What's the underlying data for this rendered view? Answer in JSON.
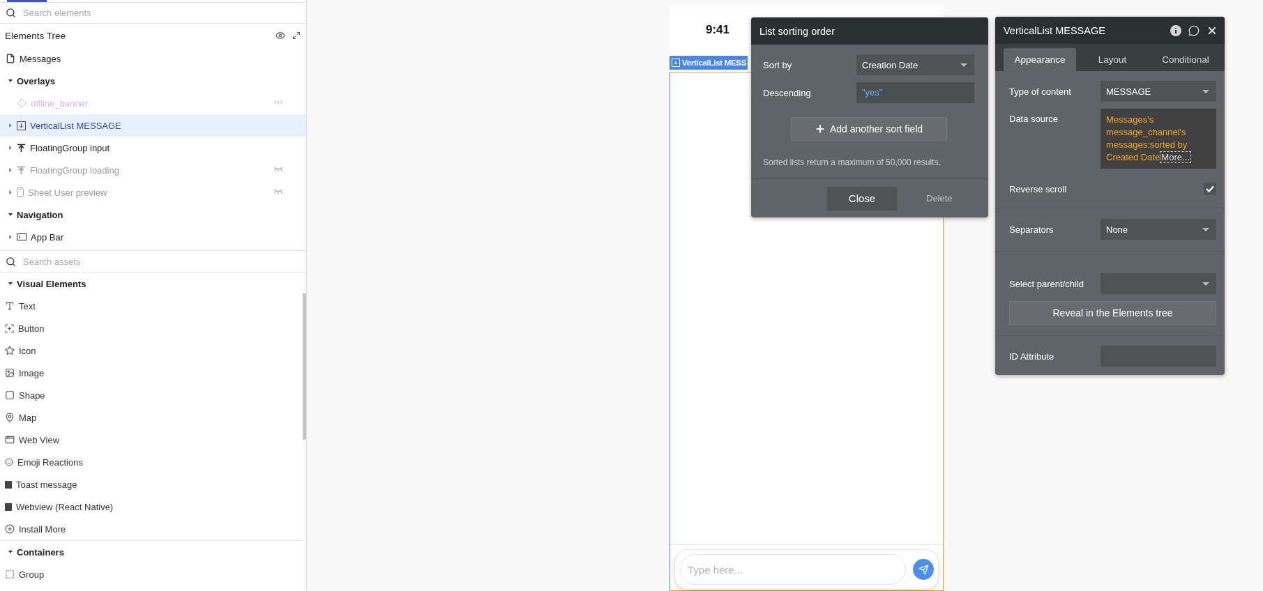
{
  "left_panel": {
    "search_elements": {
      "placeholder": "Search elements"
    },
    "elements_tree": {
      "title": "Elements Tree",
      "items": [
        {
          "label": "Messages",
          "kind": "page"
        },
        {
          "label": "Overlays",
          "kind": "section",
          "expanded": true,
          "children": [
            {
              "label": "offline_banner",
              "kind": "reusable",
              "hidden": true,
              "selected": false
            },
            {
              "label": "VerticalList MESSAGE",
              "kind": "list",
              "hidden": false,
              "selected": true,
              "expanded": false
            },
            {
              "label": "FloatingGroup input",
              "kind": "floating",
              "hidden": false,
              "selected": false,
              "expanded": false
            },
            {
              "label": "FloatingGroup loading",
              "kind": "floating",
              "hidden": true,
              "selected": false,
              "expanded": false
            },
            {
              "label": "Sheet User preview",
              "kind": "sheet",
              "hidden": true,
              "selected": false,
              "expanded": false
            }
          ]
        },
        {
          "label": "Navigation",
          "kind": "section",
          "expanded": true,
          "children": [
            {
              "label": "App Bar",
              "kind": "appbar",
              "hidden": false,
              "selected": false,
              "expanded": false
            }
          ]
        }
      ]
    },
    "search_assets": {
      "placeholder": "Search assets"
    },
    "asset_groups": [
      {
        "title": "Visual Elements",
        "expanded": true,
        "items": [
          {
            "label": "Text",
            "kind": "text"
          },
          {
            "label": "Button",
            "kind": "button"
          },
          {
            "label": "Icon",
            "kind": "star"
          },
          {
            "label": "Image",
            "kind": "image"
          },
          {
            "label": "Shape",
            "kind": "shape"
          },
          {
            "label": "Map",
            "kind": "map"
          },
          {
            "label": "Web View",
            "kind": "webview"
          },
          {
            "label": "Emoji Reactions",
            "kind": "emoji"
          },
          {
            "label": "Toast message",
            "kind": "plugin"
          },
          {
            "label": "Webview (React Native)",
            "kind": "plugin"
          },
          {
            "label": "Install More",
            "kind": "install"
          }
        ]
      },
      {
        "title": "Containers",
        "expanded": true,
        "items": [
          {
            "label": "Group",
            "kind": "group"
          }
        ]
      }
    ]
  },
  "phone": {
    "time": "9:41",
    "list_label": "VerticalList MESS",
    "input": {
      "placeholder": "Type here..."
    }
  },
  "sort_popup": {
    "title": "List sorting order",
    "rows": [
      {
        "label": "Sort by",
        "kind": "dropdown",
        "value": "Creation Date"
      },
      {
        "label": "Descending",
        "kind": "expression",
        "value": "\"yes\""
      }
    ],
    "add_button": "Add another sort field",
    "note": "Sorted lists return a maximum of 50,000 results.",
    "close_button": "Close",
    "delete_button": "Delete"
  },
  "property_panel": {
    "title": "VerticalList MESSAGE",
    "tabs": [
      {
        "label": "Appearance",
        "selected": true
      },
      {
        "label": "Layout",
        "selected": false
      },
      {
        "label": "Conditional",
        "selected": false
      }
    ],
    "sections": [
      {
        "rows": [
          {
            "label": "Type of content",
            "kind": "dropdown",
            "value": "MESSAGE"
          },
          {
            "label": "Data source",
            "kind": "expression",
            "value": "Messages's message_channel's messages:sorted by Created Date",
            "more": "More..."
          },
          {
            "label": "Reverse scroll",
            "kind": "checkbox",
            "checked": true
          }
        ]
      },
      {
        "rows": [
          {
            "label": "Separators",
            "kind": "dropdown",
            "value": "None"
          }
        ]
      },
      {
        "rows": [
          {
            "label": "Select parent/child",
            "kind": "dropdown"
          },
          {
            "label": "Reveal in the Elements tree",
            "kind": "button"
          }
        ]
      },
      {
        "rows": [
          {
            "label": "ID Attribute",
            "kind": "input"
          }
        ]
      }
    ]
  }
}
